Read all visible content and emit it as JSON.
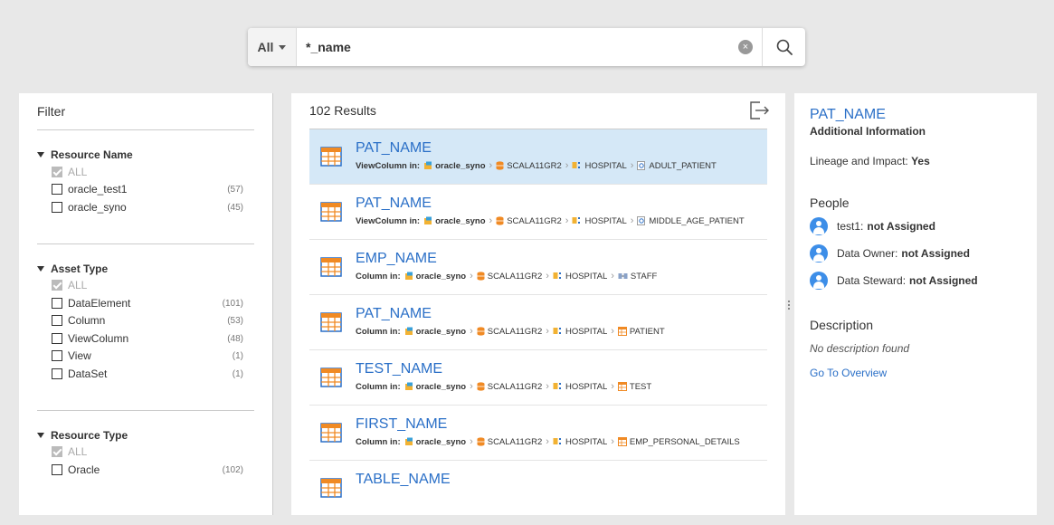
{
  "search": {
    "scope": "All",
    "query": "*_name"
  },
  "filter": {
    "title": "Filter",
    "groups": [
      {
        "title": "Resource Name",
        "options": [
          {
            "label": "ALL",
            "count": "",
            "checked": true
          },
          {
            "label": "oracle_test1",
            "count": "(57)",
            "checked": false
          },
          {
            "label": "oracle_syno",
            "count": "(45)",
            "checked": false
          }
        ]
      },
      {
        "title": "Asset Type",
        "options": [
          {
            "label": "ALL",
            "count": "",
            "checked": true
          },
          {
            "label": "DataElement",
            "count": "(101)",
            "checked": false
          },
          {
            "label": "Column",
            "count": "(53)",
            "checked": false
          },
          {
            "label": "ViewColumn",
            "count": "(48)",
            "checked": false
          },
          {
            "label": "View",
            "count": "(1)",
            "checked": false
          },
          {
            "label": "DataSet",
            "count": "(1)",
            "checked": false
          }
        ]
      },
      {
        "title": "Resource Type",
        "options": [
          {
            "label": "ALL",
            "count": "",
            "checked": true
          },
          {
            "label": "Oracle",
            "count": "(102)",
            "checked": false
          }
        ]
      }
    ]
  },
  "results": {
    "count": "102 Results",
    "items": [
      {
        "name": "PAT_NAME",
        "type": "ViewColumn in:",
        "resource": "oracle_syno",
        "db": "SCALA11GR2",
        "schema": "HOSPITAL",
        "object": "ADULT_PATIENT",
        "object_icon": "view-icon"
      },
      {
        "name": "PAT_NAME",
        "type": "ViewColumn in:",
        "resource": "oracle_syno",
        "db": "SCALA11GR2",
        "schema": "HOSPITAL",
        "object": "MIDDLE_AGE_PATIENT",
        "object_icon": "view-icon"
      },
      {
        "name": "EMP_NAME",
        "type": "Column in:",
        "resource": "oracle_syno",
        "db": "SCALA11GR2",
        "schema": "HOSPITAL",
        "object": "STAFF",
        "object_icon": "synonym-icon"
      },
      {
        "name": "PAT_NAME",
        "type": "Column in:",
        "resource": "oracle_syno",
        "db": "SCALA11GR2",
        "schema": "HOSPITAL",
        "object": "PATIENT",
        "object_icon": "table-icon"
      },
      {
        "name": "TEST_NAME",
        "type": "Column in:",
        "resource": "oracle_syno",
        "db": "SCALA11GR2",
        "schema": "HOSPITAL",
        "object": "TEST",
        "object_icon": "table-icon"
      },
      {
        "name": "FIRST_NAME",
        "type": "Column in:",
        "resource": "oracle_syno",
        "db": "SCALA11GR2",
        "schema": "HOSPITAL",
        "object": "EMP_PERSONAL_DETAILS",
        "object_icon": "table-icon"
      },
      {
        "name": "TABLE_NAME",
        "type": "",
        "resource": "",
        "db": "",
        "schema": "",
        "object": "",
        "object_icon": ""
      }
    ]
  },
  "detail": {
    "title": "PAT_NAME",
    "subtitle": "Additional Information",
    "lineage_label": "Lineage and Impact:",
    "lineage_value": "Yes",
    "people_heading": "People",
    "people": [
      {
        "role": "test1:",
        "value": "not Assigned"
      },
      {
        "role": "Data Owner:",
        "value": "not Assigned"
      },
      {
        "role": "Data Steward:",
        "value": "not Assigned"
      }
    ],
    "description_heading": "Description",
    "description": "No description found",
    "overview_link": "Go To Overview"
  },
  "colors": {
    "accent": "#2a6fc7",
    "selected_row": "#d5e8f7",
    "avatar": "#3d8ee8",
    "table_icon_orange": "#f08a24",
    "table_icon_blue": "#2a6fc7"
  }
}
